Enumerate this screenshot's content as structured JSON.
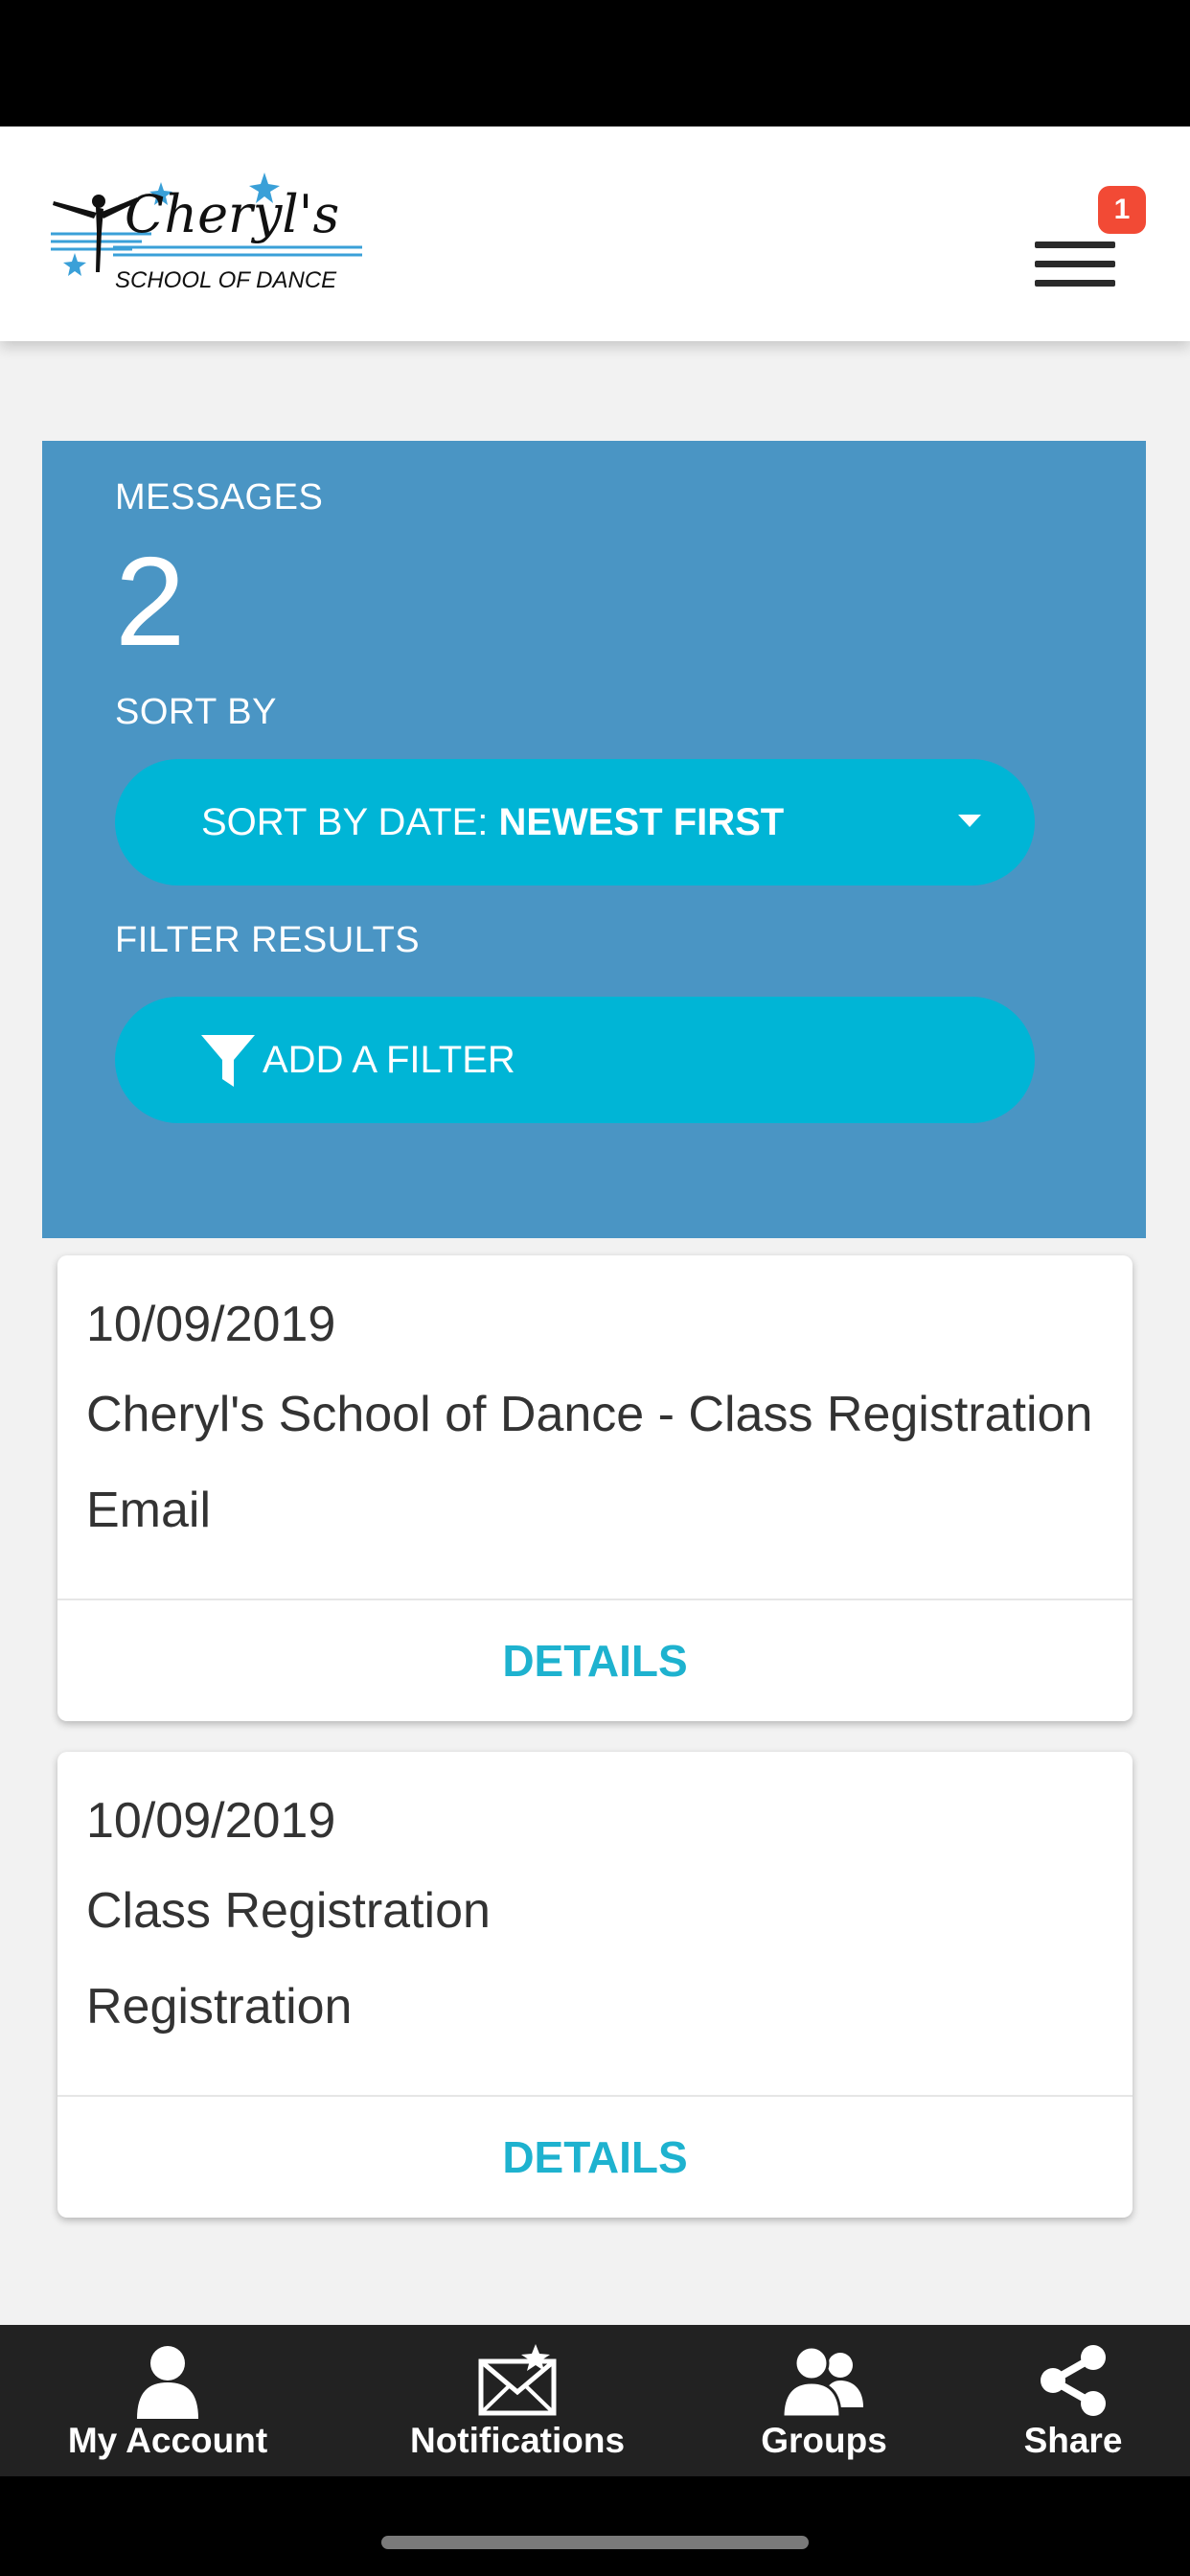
{
  "header": {
    "logo_text": "Cheryl's",
    "logo_subtext": "SCHOOL OF DANCE",
    "menu_badge": "1"
  },
  "summary": {
    "messages_label": "MESSAGES",
    "messages_count": "2",
    "sort_label": "SORT BY",
    "sort_prefix": "SORT BY DATE: ",
    "sort_value": "NEWEST FIRST",
    "filter_label": "FILTER RESULTS",
    "filter_button": "ADD A FILTER"
  },
  "messages": [
    {
      "date": "10/09/2019",
      "title": "Cheryl's School of Dance - Class Registration",
      "subtitle": "Email",
      "action": "DETAILS"
    },
    {
      "date": "10/09/2019",
      "title": "Class Registration",
      "subtitle": "Registration",
      "action": "DETAILS"
    }
  ],
  "bottom_nav": [
    {
      "label": "My Account",
      "icon": "person-icon"
    },
    {
      "label": "Notifications",
      "icon": "envelope-star-icon"
    },
    {
      "label": "Groups",
      "icon": "groups-icon"
    },
    {
      "label": "Share",
      "icon": "share-icon"
    }
  ],
  "colors": {
    "panel": "#4a95c4",
    "pill": "#00b5d6",
    "details": "#1eb2cf",
    "badge": "#f24a35",
    "nav": "#222222"
  }
}
